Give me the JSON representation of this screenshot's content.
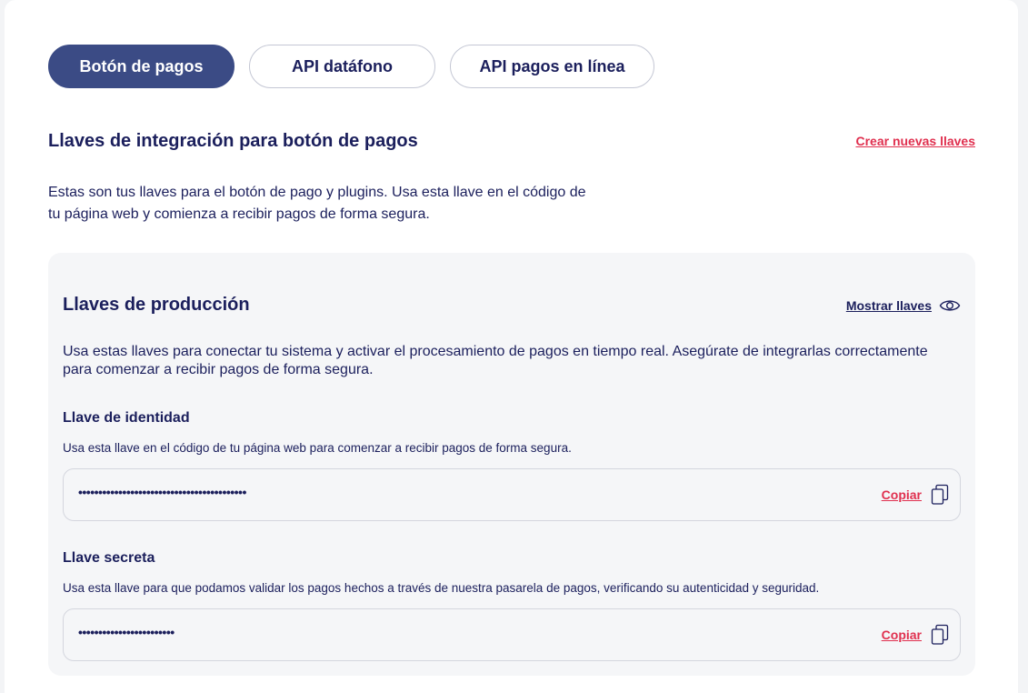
{
  "tabs": [
    {
      "label": "Botón de pagos",
      "active": true
    },
    {
      "label": "API datáfono",
      "active": false
    },
    {
      "label": "API pagos en línea",
      "active": false
    }
  ],
  "integration": {
    "title": "Llaves de integración para botón de pagos",
    "create_link": "Crear nuevas llaves",
    "description": "Estas son tus llaves para el botón de pago y plugins. Usa esta llave en el código de tu página web y comienza a recibir pagos de forma segura."
  },
  "production": {
    "title": "Llaves de producción",
    "show_keys_label": "Mostrar llaves",
    "description": "Usa estas llaves para conectar tu sistema y activar el procesamiento de pagos en tiempo real. Asegúrate de integrarlas correctamente para comenzar a recibir pagos de forma segura.",
    "identity_key": {
      "label": "Llave de identidad",
      "help": "Usa esta llave en el código de tu página web para comenzar a recibir pagos de forma segura.",
      "value": "••••••••••••••••••••••••••••••••••••••••••",
      "copy_label": "Copiar"
    },
    "secret_key": {
      "label": "Llave secreta",
      "help": "Usa esta llave para que podamos validar los pagos hechos a través de nuestra pasarela de pagos, verificando su autenticidad y seguridad.",
      "value": "••••••••••••••••••••••••",
      "copy_label": "Copiar"
    }
  },
  "colors": {
    "primary": "#3b4b85",
    "text": "#1b1f5c",
    "accent": "#e0304f",
    "panel_bg": "#f5f6f8"
  },
  "icons": {
    "show_keys": "eye-icon",
    "copy": "copy-icon"
  }
}
